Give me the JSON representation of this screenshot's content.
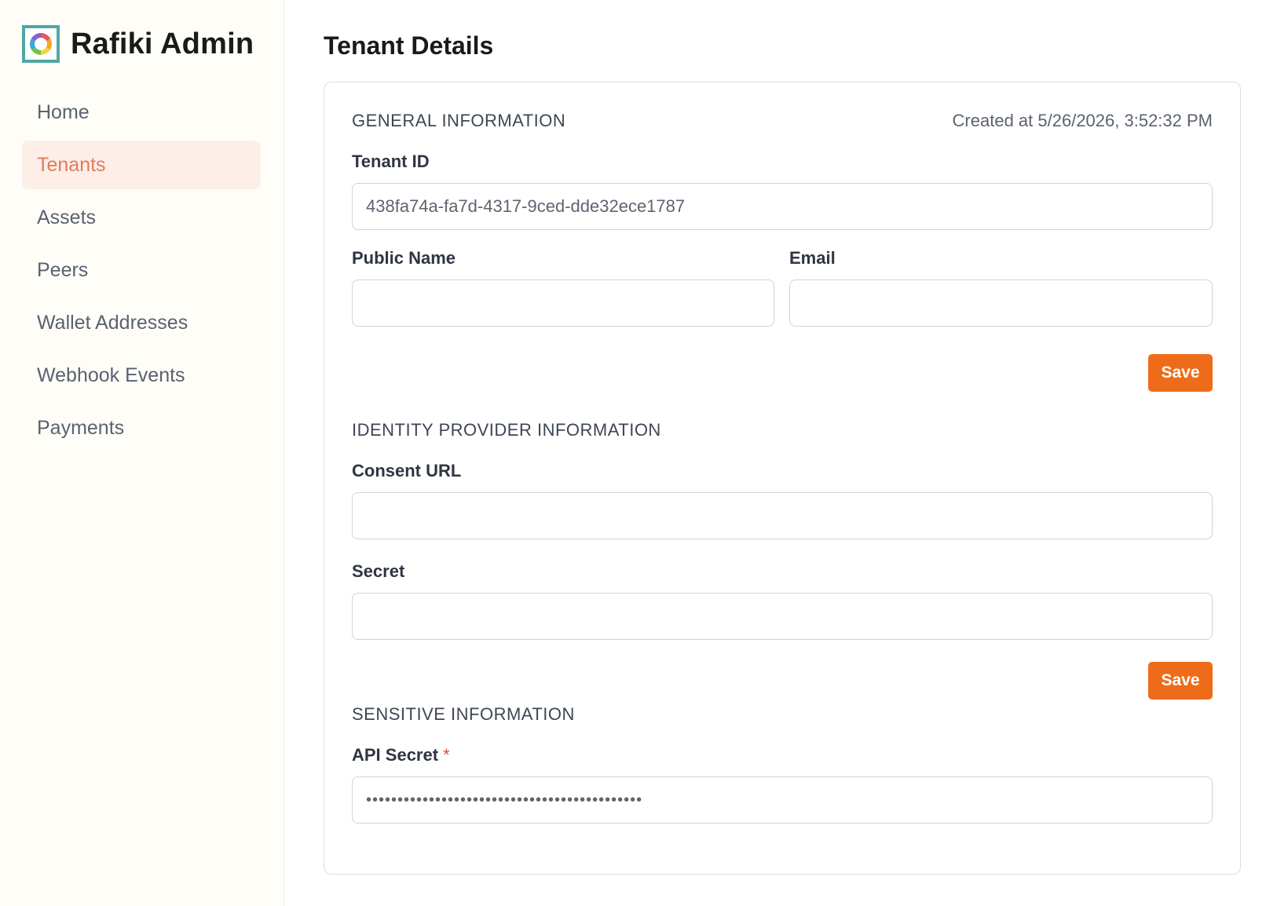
{
  "app": {
    "title": "Rafiki Admin",
    "logo_icon": "rafiki-logo-icon"
  },
  "nav": {
    "items": [
      {
        "label": "Home",
        "active": false
      },
      {
        "label": "Tenants",
        "active": true
      },
      {
        "label": "Assets",
        "active": false
      },
      {
        "label": "Peers",
        "active": false
      },
      {
        "label": "Wallet Addresses",
        "active": false
      },
      {
        "label": "Webhook Events",
        "active": false
      },
      {
        "label": "Payments",
        "active": false
      }
    ]
  },
  "page": {
    "title": "Tenant Details"
  },
  "general": {
    "heading": "GENERAL INFORMATION",
    "created_at": "Created at 5/26/2026, 3:52:32 PM",
    "tenant_id_label": "Tenant ID",
    "tenant_id_value": "438fa74a-fa7d-4317-9ced-dde32ece1787",
    "public_name_label": "Public Name",
    "public_name_value": "",
    "email_label": "Email",
    "email_value": "",
    "save_label": "Save"
  },
  "identity": {
    "heading": "IDENTITY PROVIDER INFORMATION",
    "consent_url_label": "Consent URL",
    "consent_url_value": "",
    "secret_label": "Secret",
    "secret_value": "",
    "save_label": "Save"
  },
  "sensitive": {
    "heading": "SENSITIVE INFORMATION",
    "api_secret_label": "API Secret",
    "required_mark": "*",
    "api_secret_value": "••••••••••••••••••••••••••••••••••••••••••••"
  },
  "colors": {
    "accent": "#ee6c19",
    "nav_active_bg": "#fdeee8",
    "nav_active_text": "#e27b5a",
    "sidebar_bg": "#fffdf7"
  }
}
